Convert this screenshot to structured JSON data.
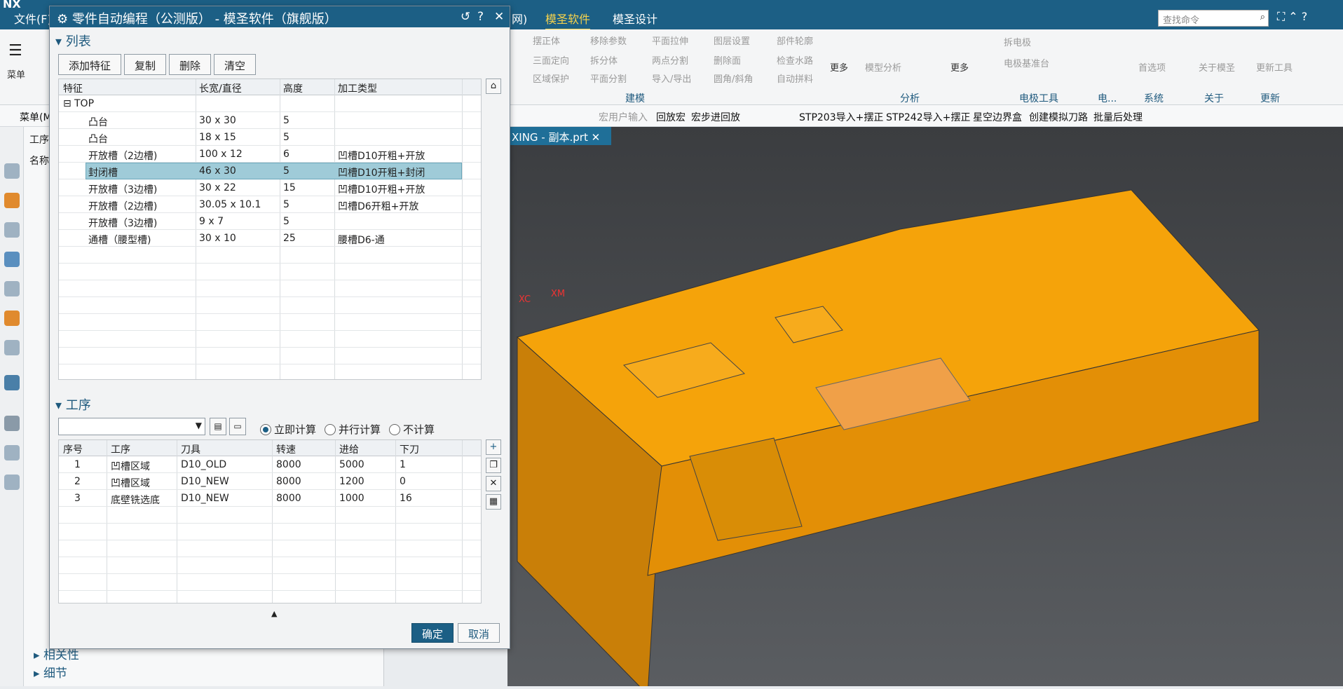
{
  "app": {
    "file_menu": "文件(F)",
    "logo": "NX",
    "top_tabs": [
      "网)",
      "模圣软件",
      "模圣设计"
    ],
    "active_tab": "模圣软件",
    "search_placeholder": "查找命令"
  },
  "ribbon": {
    "menu_label": "菜单",
    "jianmo_items": [
      "摆正体",
      "移除参数",
      "平面拉伸",
      "图层设置",
      "部件轮廓",
      "三面定向",
      "拆分体",
      "两点分割",
      "删除面",
      "检查水路",
      "区域保护",
      "平面分割",
      "导入/导出",
      "圆角/斜角",
      "自动拼料"
    ],
    "more1": "更多",
    "analysis_item": "模型分析",
    "more2": "更多",
    "electrode_items": [
      "拆电极",
      "电极基准台"
    ],
    "first_option": "首选项",
    "about": "关于模圣",
    "update": "更新工具",
    "groups": [
      "建模",
      "分析",
      "电极工具",
      "电...",
      "系统",
      "关于",
      "更新"
    ]
  },
  "cmdbar": {
    "items": [
      "宏用户输入",
      "回放宏",
      "宏步进回放",
      "STP203导入+摆正",
      "STP242导入+摆正",
      "星空边界盒",
      "创建模拟刀路",
      "批量后处理"
    ],
    "menu": "菜单(M)"
  },
  "file_tab": "XING - 副本.prt",
  "nav_labels": [
    "工序",
    "名称"
  ],
  "dialog": {
    "title": "零件自动编程（公测版） - 模圣软件（旗舰版）",
    "section_list": "列表",
    "buttons": [
      "添加特征",
      "复制",
      "删除",
      "清空"
    ],
    "feature_headers": [
      "特征",
      "长宽/直径",
      "高度",
      "加工类型"
    ],
    "features": [
      {
        "name": "TOP",
        "size": "",
        "height": "",
        "type": "",
        "root": true
      },
      {
        "name": "凸台",
        "size": "30 x 30",
        "height": "5",
        "type": ""
      },
      {
        "name": "凸台",
        "size": "18 x 15",
        "height": "5",
        "type": ""
      },
      {
        "name": "开放槽（2边槽)",
        "size": "100 x 12",
        "height": "6",
        "type": "凹槽D10开粗+开放"
      },
      {
        "name": "封闭槽",
        "size": "46 x 30",
        "height": "5",
        "type": "凹槽D10开粗+封闭",
        "selected": true
      },
      {
        "name": "开放槽（3边槽)",
        "size": "30 x 22",
        "height": "15",
        "type": "凹槽D10开粗+开放"
      },
      {
        "name": "开放槽（2边槽)",
        "size": "30.05 x 10.1",
        "height": "5",
        "type": "凹槽D6开粗+开放"
      },
      {
        "name": "开放槽（3边槽)",
        "size": "9 x 7",
        "height": "5",
        "type": ""
      },
      {
        "name": "通槽（腰型槽)",
        "size": "30 x 10",
        "height": "25",
        "type": "腰槽D6-通"
      }
    ],
    "section_ops": "工序",
    "radios": [
      "立即计算",
      "并行计算",
      "不计算"
    ],
    "radio_selected": "立即计算",
    "op_headers": [
      "序号",
      "工序",
      "刀具",
      "转速",
      "进给",
      "下刀"
    ],
    "ops": [
      {
        "no": "1",
        "op": "凹槽区域",
        "tool": "D10_OLD",
        "speed": "8000",
        "feed": "5000",
        "down": "1"
      },
      {
        "no": "2",
        "op": "凹槽区域",
        "tool": "D10_NEW",
        "speed": "8000",
        "feed": "1200",
        "down": "0"
      },
      {
        "no": "3",
        "op": "底壁铣选底",
        "tool": "D10_NEW",
        "speed": "8000",
        "feed": "1000",
        "down": "16"
      }
    ],
    "ok": "确定",
    "cancel": "取消"
  },
  "bottom_sections": [
    "相关性",
    "细节"
  ],
  "axis_labels": [
    "XC",
    "XM"
  ],
  "colors": {
    "accent": "#1c5f85",
    "part": "#f5a30a",
    "viewport": "#4a4c50"
  }
}
